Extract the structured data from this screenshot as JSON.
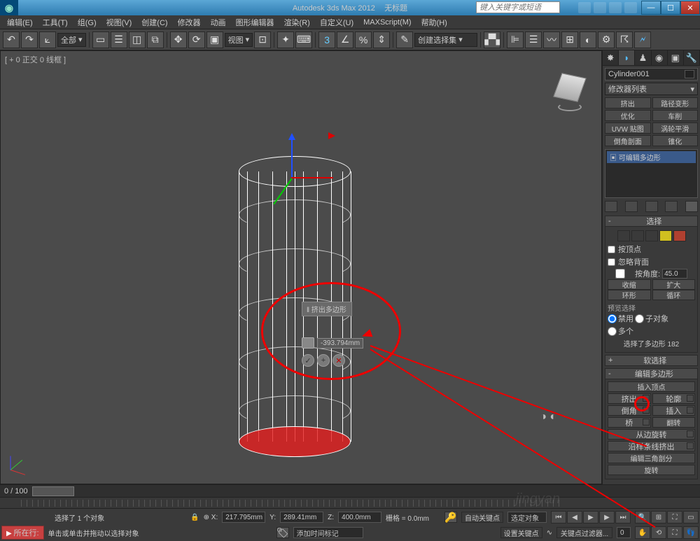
{
  "title": {
    "app": "Autodesk 3ds Max  2012",
    "doc": "无标题",
    "search_ph": "键入关键字或短语"
  },
  "menu": [
    "编辑(E)",
    "工具(T)",
    "组(G)",
    "视图(V)",
    "创建(C)",
    "修改器",
    "动画",
    "图形编辑器",
    "渲染(R)",
    "自定义(U)",
    "MAXScript(M)",
    "帮助(H)"
  ],
  "toolbar": {
    "selset": "全部",
    "view": "视图",
    "createset": "创建选择集"
  },
  "viewport": {
    "label": "[ + 0 正交 0 线框 ]"
  },
  "popup": {
    "title": "‖ 挤出多边形",
    "value": "-393.794mm"
  },
  "cmd": {
    "objname": "Cylinder001",
    "modlist": "修改器列表",
    "mods": [
      [
        "挤出",
        "路径变形"
      ],
      [
        "优化",
        "车削"
      ],
      [
        "UVW 贴图",
        "涡轮平滑"
      ],
      [
        "倒角剖面",
        "锥化"
      ]
    ],
    "stack": "▣ 可编辑多边形",
    "select": {
      "title": "选择",
      "byVertex": "按顶点",
      "ignoreBack": "忽略背面",
      "byAngle": "按角度:",
      "angle": "45.0",
      "shrink": "收缩",
      "grow": "扩大",
      "ring": "环形",
      "loop": "循环",
      "preview": "预览选择",
      "off": "禁用",
      "sub": "子对象",
      "multi": "多个",
      "count": "选择了多边形 182"
    },
    "soft": "软选择",
    "edit": {
      "title": "编辑多边形",
      "insVert": "插入顶点",
      "extrude": "挤出",
      "outline": "轮廓",
      "bevel": "倒角",
      "inset": "插入",
      "bridge": "桥",
      "flip": "翻转",
      "fromEdge": "从边旋转",
      "alongSpline": "沿样条线挤出",
      "editTri": "编辑三角剖分",
      "retri": "旋转"
    }
  },
  "time": {
    "range": "0 / 100"
  },
  "status": {
    "sel": "选择了 1 个对象",
    "prompt": "单击或单击并拖动以选择对象",
    "now": "所在行:",
    "addTime": "添加时间标记",
    "x": "217.795mm",
    "y": "289.41mm",
    "z": "400.0mm",
    "grid": "栅格 = 0.0mm",
    "autokey": "自动关键点",
    "selLock": "选定对象",
    "setkey": "设置关键点",
    "keyfilter": "关键点过滤器..."
  }
}
